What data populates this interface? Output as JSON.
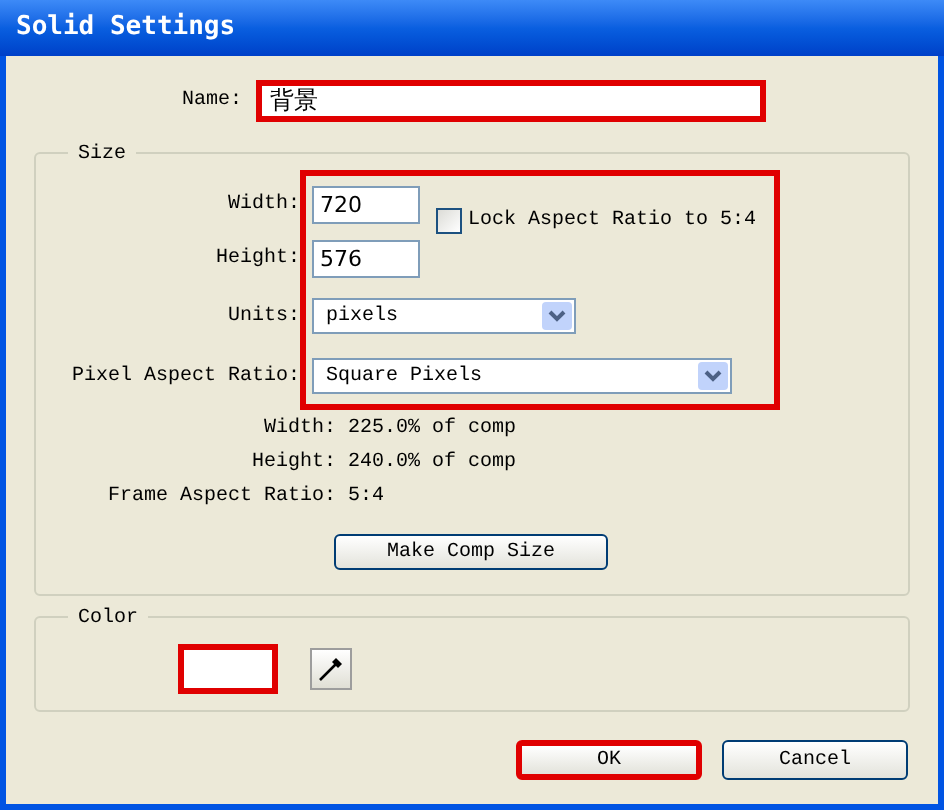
{
  "window": {
    "title": "Solid Settings"
  },
  "name_field": {
    "label": "Name:",
    "value": "背景",
    "highlighted": true
  },
  "size": {
    "legend": "Size",
    "highlighted": true,
    "width": {
      "label": "Width:",
      "value": "720"
    },
    "height": {
      "label": "Height:",
      "value": "576"
    },
    "lock_aspect": {
      "label": "Lock Aspect Ratio to 5:4",
      "checked": false
    },
    "units": {
      "label": "Units:",
      "value": "pixels"
    },
    "pixel_aspect_ratio": {
      "label": "Pixel Aspect Ratio:",
      "value": "Square Pixels"
    },
    "info": [
      {
        "label": "Width:",
        "value": "225.0% of comp"
      },
      {
        "label": "Height:",
        "value": "240.0% of comp"
      },
      {
        "label": "Frame Aspect Ratio:",
        "value": "5:4"
      }
    ],
    "make_comp_size_button": "Make Comp Size"
  },
  "color": {
    "legend": "Color",
    "color": "#ffffff",
    "highlighted": true
  },
  "buttons": [
    {
      "label": "OK",
      "highlighted": true
    },
    {
      "label": "Cancel",
      "highlighted": false
    }
  ]
}
